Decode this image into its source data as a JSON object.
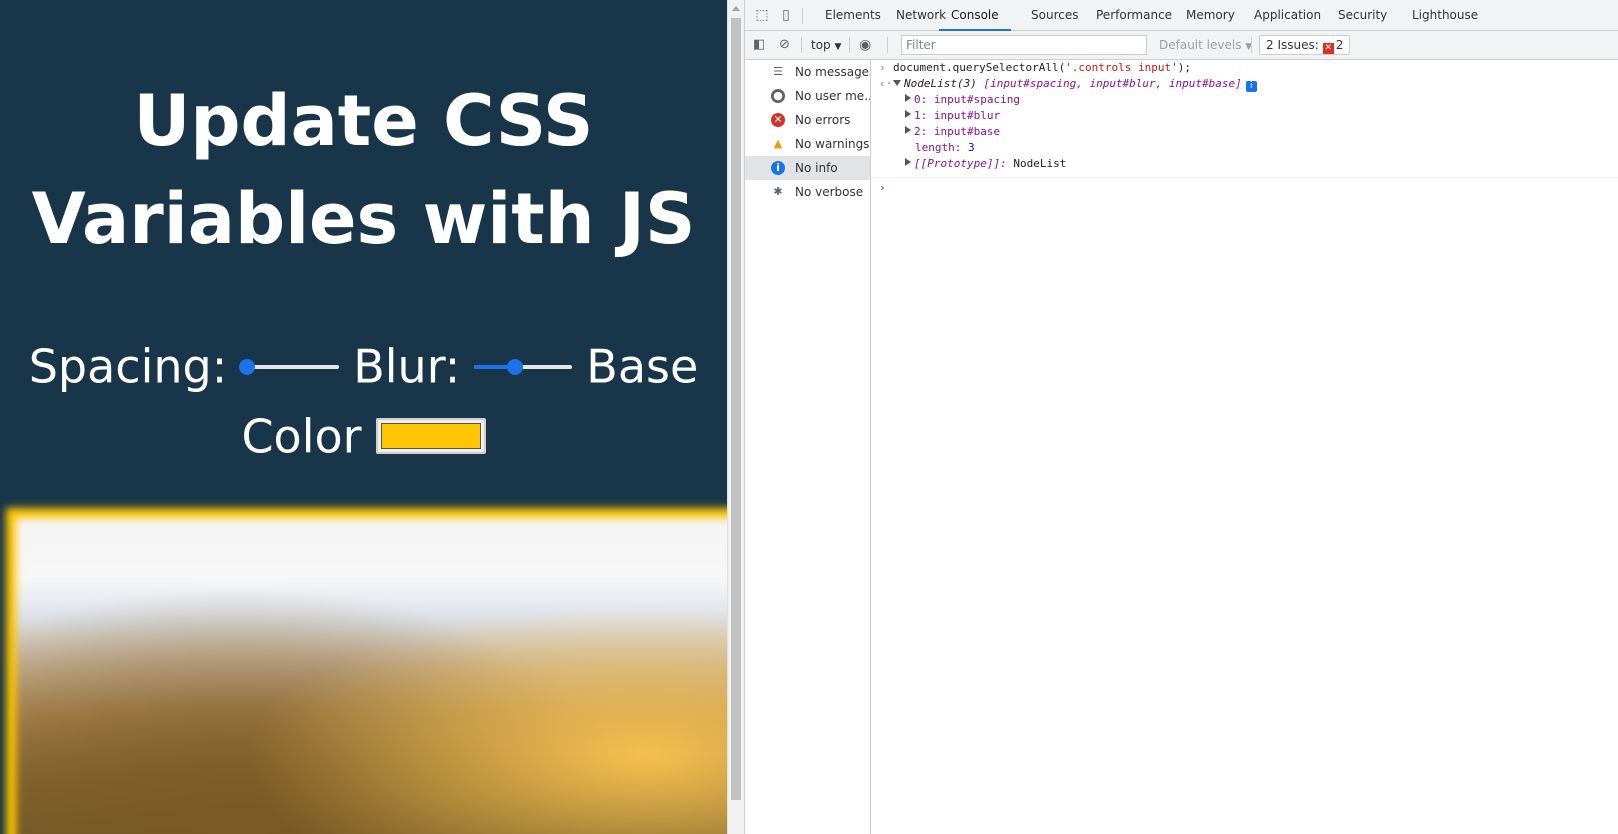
{
  "page": {
    "title_line1": "Update CSS",
    "title_line2": "Variables with JS",
    "spacing_label": "Spacing:",
    "blur_label": "Blur:",
    "base_color_label_line1": "Base",
    "base_color_label_line2": "Color",
    "spacing_value_fraction": 0.06,
    "blur_value_fraction": 0.42,
    "base_color": "#ffc600",
    "background_color": "#193549"
  },
  "devtools": {
    "tabs": [
      "Elements",
      "Network",
      "Console",
      "Sources",
      "Performance",
      "Memory",
      "Application",
      "Security",
      "Lighthouse"
    ],
    "active_tab": "Console",
    "toolbar": {
      "context": "top",
      "filter_placeholder": "Filter",
      "levels": "Default levels",
      "issues_label": "2 Issues:",
      "issues_count": "2"
    },
    "sidebar": [
      {
        "label": "No messages",
        "icon": "list-icon"
      },
      {
        "label": "No user me...",
        "icon": "user-icon"
      },
      {
        "label": "No errors",
        "icon": "error-icon"
      },
      {
        "label": "No warnings",
        "icon": "warning-icon"
      },
      {
        "label": "No info",
        "icon": "info-icon",
        "selected": true
      },
      {
        "label": "No verbose",
        "icon": "bug-icon"
      }
    ],
    "console": {
      "command_prefix": "document.querySelectorAll(",
      "command_arg": "'.controls input'",
      "command_suffix": ");",
      "result_head": "NodeList(3)",
      "result_items_preview": "[input#spacing, input#blur, input#base]",
      "items": [
        {
          "key": "0:",
          "value": "input#spacing"
        },
        {
          "key": "1:",
          "value": "input#blur"
        },
        {
          "key": "2:",
          "value": "input#base"
        }
      ],
      "length_key": "length:",
      "length_value": "3",
      "prototype_key": "[[Prototype]]:",
      "prototype_value": "NodeList"
    },
    "accent_color": "#1a73e8"
  }
}
